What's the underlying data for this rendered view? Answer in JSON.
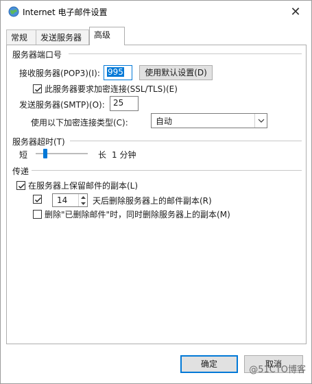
{
  "window": {
    "title": "Internet 电子邮件设置",
    "close_glyph": "✕"
  },
  "tabs": [
    {
      "label": "常规",
      "active": false
    },
    {
      "label": "发送服务器",
      "active": false
    },
    {
      "label": "高级",
      "active": true
    }
  ],
  "ports": {
    "group_title": "服务器端口号",
    "incoming_label": "接收服务器(POP3)(I):",
    "incoming_value": "995",
    "default_button": "使用默认设置(D)",
    "ssl_checkbox_label": "此服务器要求加密连接(SSL/TLS)(E)",
    "ssl_checked": true,
    "outgoing_label": "发送服务器(SMTP)(O):",
    "outgoing_value": "25",
    "encryption_label": "使用以下加密连接类型(C):",
    "encryption_value": "自动"
  },
  "timeout": {
    "group_title": "服务器超时(T)",
    "short_label": "短",
    "long_label": "长",
    "value_text": "1 分钟",
    "level": 0.18
  },
  "delivery": {
    "group_title": "传递",
    "leave_copy_label": "在服务器上保留邮件的副本(L)",
    "leave_copy_checked": true,
    "remove_after_checked": true,
    "remove_after_days": "14",
    "remove_after_label": "天后删除服务器上的邮件副本(R)",
    "remove_deleted_label": "删除\"已删除邮件\"时，同时删除服务器上的副本(M)",
    "remove_deleted_checked": false
  },
  "footer": {
    "ok_label": "确定",
    "cancel_label": "取消"
  },
  "watermark": "@51CTO博客",
  "colors": {
    "accent": "#0078d7",
    "button_face": "#e1e1e1"
  }
}
